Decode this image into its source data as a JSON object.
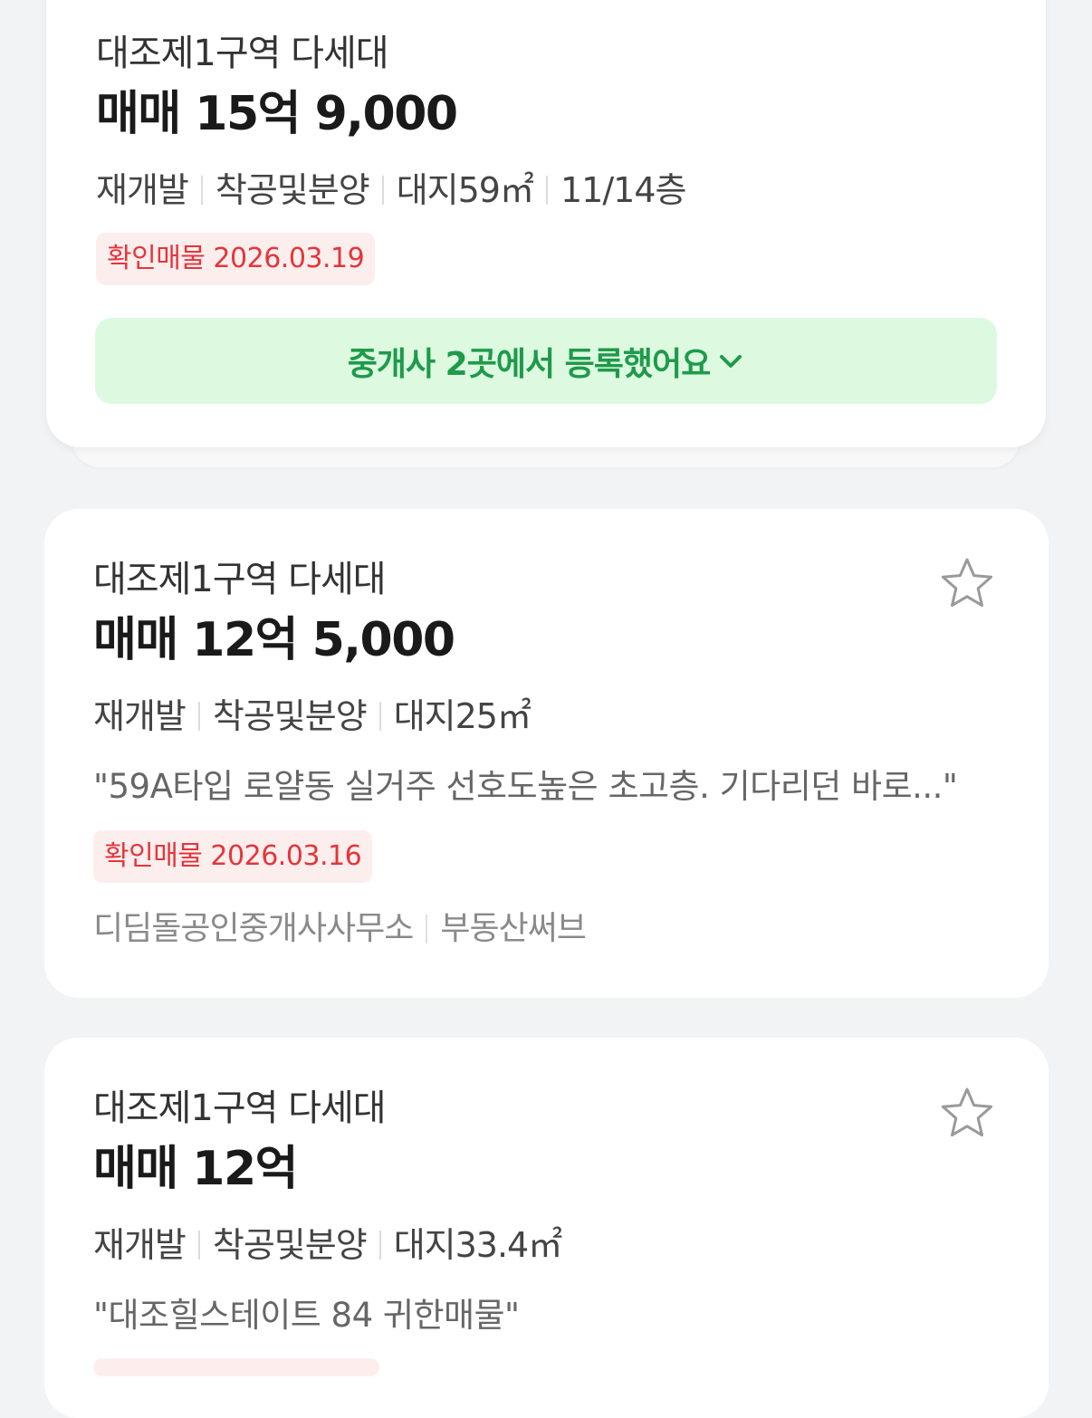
{
  "listings": [
    {
      "title": "대조제1구역 다세대",
      "price": "매매 15억 9,000",
      "specs": [
        "재개발",
        "착공및분양",
        "대지59㎡",
        "11/14층"
      ],
      "badge": "확인매물 2026.03.19",
      "cta_label": "중개사 2곳에서 등록했어요"
    },
    {
      "title": "대조제1구역 다세대",
      "price": "매매 12억 5,000",
      "specs": [
        "재개발",
        "착공및분양",
        "대지25㎡"
      ],
      "description": "\"59A타입 로얄동 실거주 선호도높은 초고층. 기다리던 바로...\"",
      "badge": "확인매물 2026.03.16",
      "agencies": [
        "디딤돌공인중개사사무소",
        "부동산써브"
      ]
    },
    {
      "title": "대조제1구역 다세대",
      "price": "매매 12억",
      "specs": [
        "재개발",
        "착공및분양",
        "대지33.4㎡"
      ],
      "description": "\"대조힐스테이트 84 귀한매물\""
    }
  ],
  "colors": {
    "background": "#f2f3f5",
    "badge_text": "#e5353a",
    "badge_bg": "#fdeeee",
    "cta_text": "#1f9a4b",
    "cta_bg": "#ddfae1"
  },
  "icons": {
    "cta_chevron": "chevron-down-icon",
    "favorite": "star-outline-icon"
  }
}
